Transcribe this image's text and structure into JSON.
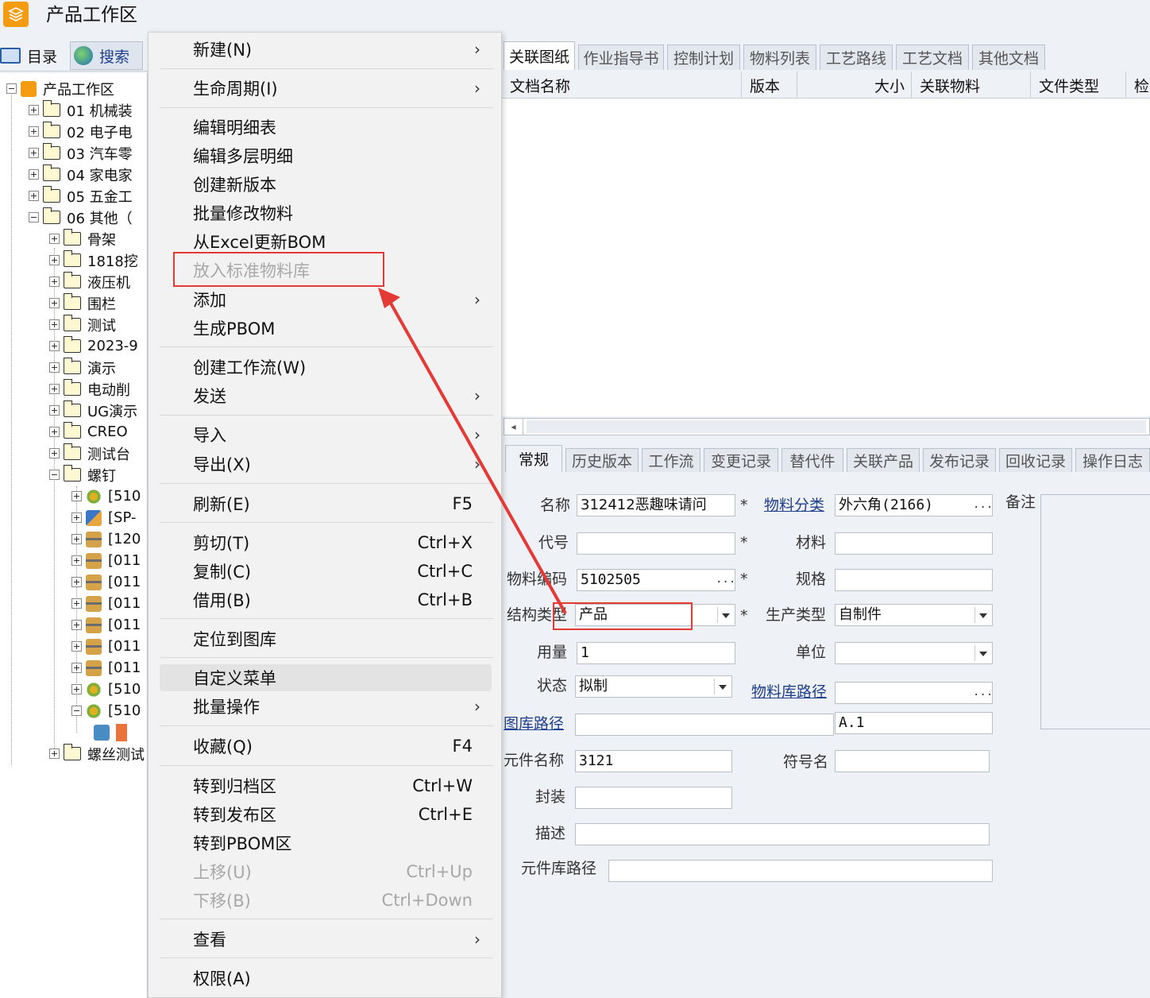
{
  "window": {
    "title": "产品工作区"
  },
  "left_tabs": {
    "catalog": "目录",
    "search": "搜索"
  },
  "tree": {
    "root": "产品工作区",
    "items": [
      "01 机械装",
      "02 电子电",
      "03 汽车零",
      "04 家电家",
      "05 五金工",
      "06 其他（"
    ],
    "sub": [
      "骨架",
      "1818挖",
      "液压机",
      "围栏",
      "测试",
      "2023-9",
      "演示",
      "电动削",
      "UG演示",
      "CREO",
      "测试台",
      "螺钉"
    ],
    "parts": [
      "[510",
      "[SP-",
      "[120",
      "[011",
      "[011",
      "[011",
      "[011",
      "[011",
      "[011",
      "[510",
      "[510"
    ],
    "last": "螺丝测试"
  },
  "menu": {
    "new": "新建(N)",
    "lifecycle": "生命周期(I)",
    "edit_bom": "编辑明细表",
    "edit_multi": "编辑多层明细",
    "new_version": "创建新版本",
    "batch_modify": "批量修改物料",
    "excel_bom": "从Excel更新BOM",
    "std_lib": "放入标准物料库",
    "add": "添加",
    "pbom": "生成PBOM",
    "workflow": "创建工作流(W)",
    "send": "发送",
    "import": "导入",
    "export": "导出(X)",
    "refresh": "刷新(E)",
    "refresh_sc": "F5",
    "cut": "剪切(T)",
    "cut_sc": "Ctrl+X",
    "copy": "复制(C)",
    "copy_sc": "Ctrl+C",
    "borrow": "借用(B)",
    "borrow_sc": "Ctrl+B",
    "locate": "定位到图库",
    "custom": "自定义菜单",
    "batch": "批量操作",
    "favorite": "收藏(Q)",
    "favorite_sc": "F4",
    "archive": "转到归档区",
    "archive_sc": "Ctrl+W",
    "publish": "转到发布区",
    "publish_sc": "Ctrl+E",
    "to_pbom": "转到PBOM区",
    "up": "上移(U)",
    "up_sc": "Ctrl+Up",
    "down": "下移(B)",
    "down_sc": "Ctrl+Down",
    "view": "查看",
    "permission": "权限(A)",
    "submenu_arrow": "›"
  },
  "top_tabs": [
    "关联图纸",
    "作业指导书",
    "控制计划",
    "物料列表",
    "工艺路线",
    "工艺文档",
    "其他文档"
  ],
  "doc_columns": [
    "文档名称",
    "版本",
    "大小",
    "关联物料",
    "文件类型",
    "检"
  ],
  "bottom_tabs": [
    "常规",
    "历史版本",
    "工作流",
    "变更记录",
    "替代件",
    "关联产品",
    "发布记录",
    "回收记录",
    "操作日志"
  ],
  "form": {
    "name_label": "名称",
    "name_value": "312412恶趣味请问",
    "category_label": "物料分类",
    "category_value": "外六角(2166)",
    "remarks_label": "备注",
    "code_label": "代号",
    "code_value": "",
    "material_label": "材料",
    "material_value": "",
    "part_no_label": "物料编码",
    "part_no_value": "5102505",
    "spec_label": "规格",
    "spec_value": "",
    "struct_label": "结构类型",
    "struct_value": "产品",
    "prod_type_label": "生产类型",
    "prod_type_value": "自制件",
    "qty_label": "用量",
    "qty_value": "1",
    "unit_label": "单位",
    "unit_value": "",
    "status_label": "状态",
    "status_value": "拟制",
    "lib_path_label": "物料库路径",
    "lib_path_value": "",
    "drawing_path_label": "图库路径",
    "drawing_path_value": "",
    "version_value": "A.1",
    "comp_name_label": "元件名称",
    "comp_name_value": "3121",
    "symbol_label": "符号名",
    "symbol_value": "",
    "package_label": "封装",
    "package_value": "",
    "desc_label": "描述",
    "desc_value": "",
    "comp_lib_label": "元件库路径",
    "comp_lib_value": "",
    "required_mark": "*",
    "ellipsis": "...",
    "scroll_left": "◂"
  },
  "colors": {
    "annotation": "#e53935",
    "link": "#1f3f8f"
  }
}
